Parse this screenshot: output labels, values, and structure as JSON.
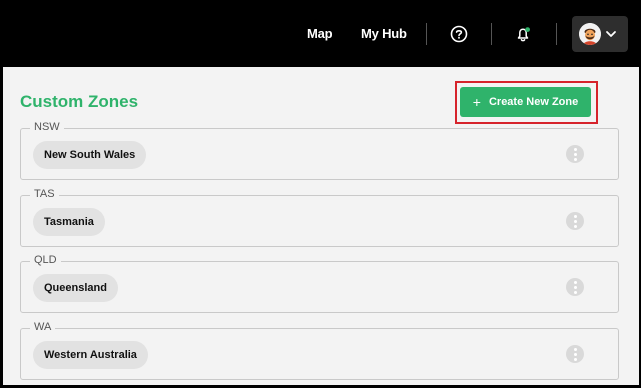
{
  "nav": {
    "map_label": "Map",
    "hub_label": "My Hub",
    "help_icon": "question-circle-icon",
    "bell_icon": "bell-icon",
    "notification_dot_color": "#2fb36b"
  },
  "main": {
    "title": "Custom Zones",
    "title_color": "#2fb36b",
    "create_button": {
      "label": "Create New Zone",
      "icon": "plus-icon",
      "color": "#2fb36b"
    },
    "zones": [
      {
        "code": "NSW",
        "name": "New South Wales"
      },
      {
        "code": "TAS",
        "name": "Tasmania"
      },
      {
        "code": "QLD",
        "name": "Queensland"
      },
      {
        "code": "WA",
        "name": "Western Australia"
      }
    ]
  }
}
